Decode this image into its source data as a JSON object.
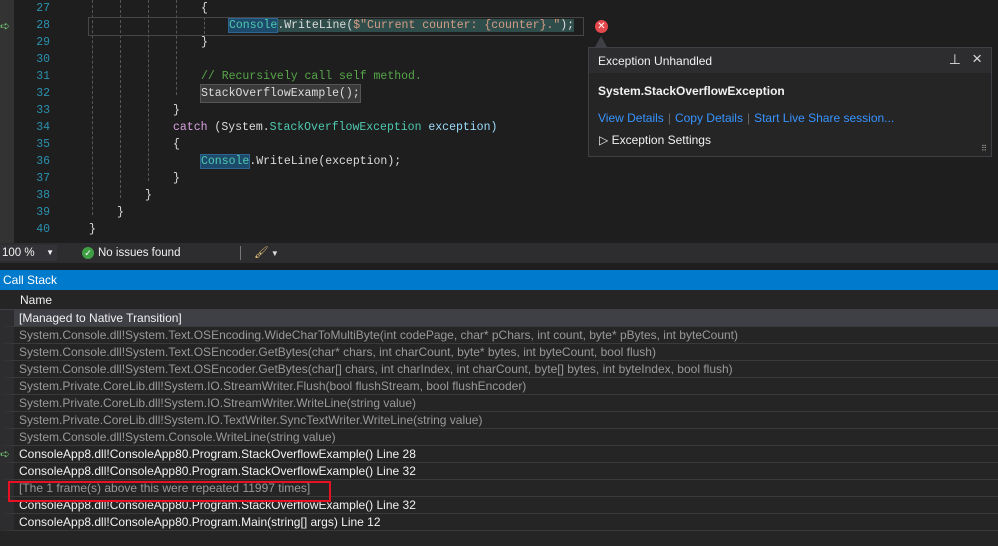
{
  "editor": {
    "lines": [
      {
        "n": "27"
      },
      {
        "n": "28"
      },
      {
        "n": "29"
      },
      {
        "n": "30"
      },
      {
        "n": "31"
      },
      {
        "n": "32"
      },
      {
        "n": "33"
      },
      {
        "n": "34"
      },
      {
        "n": "35"
      },
      {
        "n": "36"
      },
      {
        "n": "37"
      },
      {
        "n": "38"
      },
      {
        "n": "39"
      },
      {
        "n": "40"
      }
    ],
    "t": {
      "brace_open": "{",
      "brace_close": "}",
      "console": "Console",
      "writeline_str_open": ".WriteLine(",
      "str": "$\"Current counter: {counter}.\"",
      "close": ");",
      "comment": "// Recursively call self method.",
      "recurse": "StackOverflowExample();",
      "catch": "catch",
      "paren_open": " (System.",
      "exc_type": "StackOverflowException",
      "exc_var": " exception)",
      "writeline_exc": ".WriteLine(exception);"
    }
  },
  "popup": {
    "title": "Exception Unhandled",
    "exception": "System.StackOverflowException",
    "links": [
      "View Details",
      "Copy Details",
      "Start Live Share session..."
    ],
    "settings": "Exception Settings"
  },
  "status": {
    "zoom": "100 %",
    "issues": "No issues found"
  },
  "callstack": {
    "title": "Call Stack",
    "column": "Name",
    "rows": [
      {
        "text": "[Managed to Native Transition]"
      },
      {
        "text": "System.Console.dll!System.Text.OSEncoding.WideCharToMultiByte(int codePage, char* pChars, int count, byte* pBytes, int byteCount)"
      },
      {
        "text": "System.Console.dll!System.Text.OSEncoder.GetBytes(char* chars, int charCount, byte* bytes, int byteCount, bool flush)"
      },
      {
        "text": "System.Console.dll!System.Text.OSEncoder.GetBytes(char[] chars, int charIndex, int charCount, byte[] bytes, int byteIndex, bool flush)"
      },
      {
        "text": "System.Private.CoreLib.dll!System.IO.StreamWriter.Flush(bool flushStream, bool flushEncoder)"
      },
      {
        "text": "System.Private.CoreLib.dll!System.IO.StreamWriter.WriteLine(string value)"
      },
      {
        "text": "System.Private.CoreLib.dll!System.IO.TextWriter.SyncTextWriter.WriteLine(string value)"
      },
      {
        "text": "System.Console.dll!System.Console.WriteLine(string value)"
      },
      {
        "text": "ConsoleApp8.dll!ConsoleApp80.Program.StackOverflowExample() Line 28"
      },
      {
        "text": "ConsoleApp8.dll!ConsoleApp80.Program.StackOverflowExample() Line 32"
      },
      {
        "text": "[The 1 frame(s) above this were repeated 11997 times]"
      },
      {
        "text": "ConsoleApp8.dll!ConsoleApp80.Program.StackOverflowExample() Line 32"
      },
      {
        "text": "ConsoleApp8.dll!ConsoleApp80.Program.Main(string[] args) Line 12"
      }
    ]
  }
}
